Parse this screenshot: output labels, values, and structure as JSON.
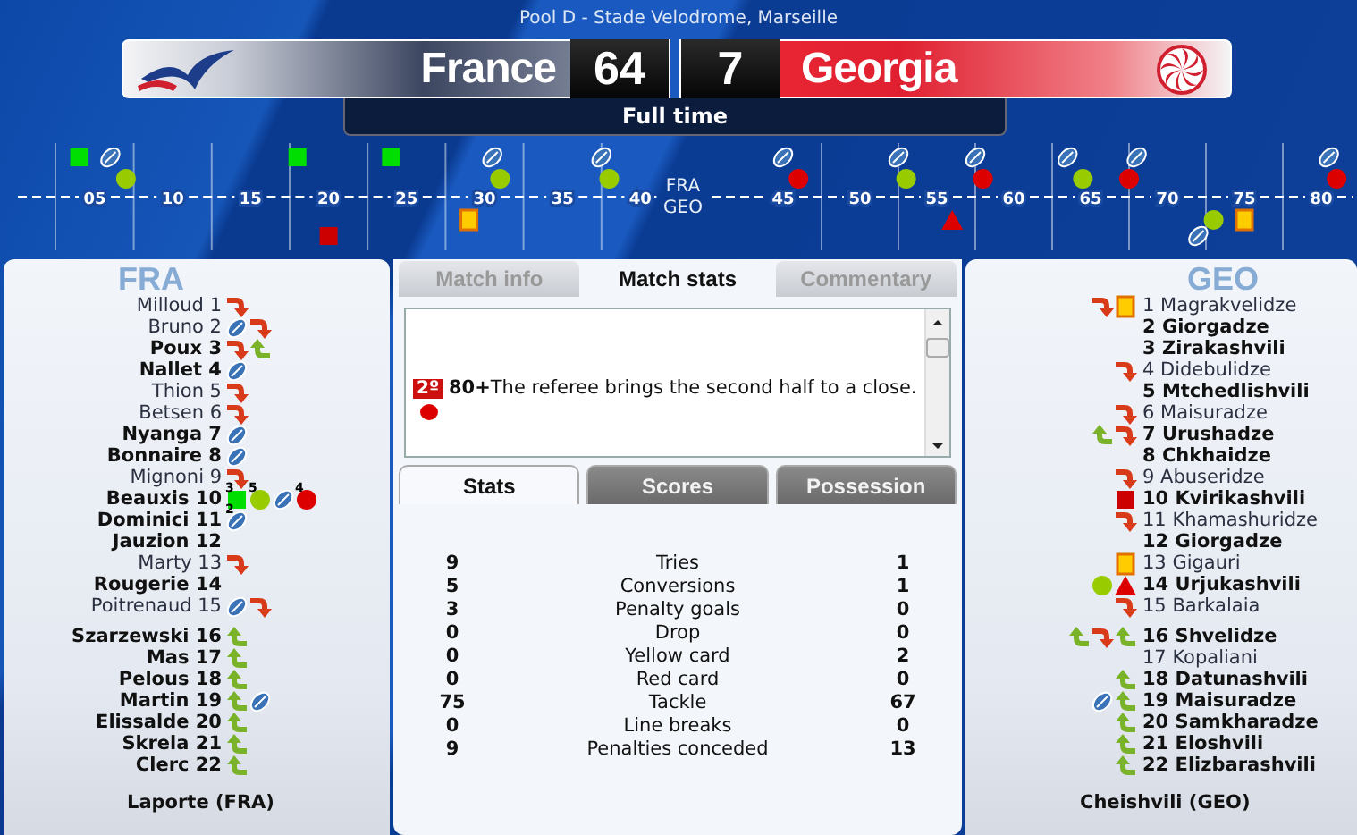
{
  "header": {
    "venue": "Pool D - Stade Velodrome, Marseille",
    "home": {
      "name": "France",
      "score": "64"
    },
    "away": {
      "name": "Georgia",
      "score": "7"
    },
    "status": "Full time"
  },
  "timeline": {
    "home_label": "FRA",
    "away_label": "GEO",
    "minute_labels": [
      "05",
      "10",
      "15",
      "20",
      "25",
      "30",
      "35",
      "40",
      "45",
      "50",
      "55",
      "60",
      "65",
      "70",
      "75",
      "80"
    ]
  },
  "teams": [
    {
      "code": "FRA",
      "starters": [
        {
          "name": "Milloud",
          "number": "1",
          "bold": false,
          "events": [
            {
              "kind": "sub_off"
            }
          ]
        },
        {
          "name": "Bruno",
          "number": "2",
          "bold": false,
          "events": [
            {
              "kind": "try"
            },
            {
              "kind": "sub_off"
            }
          ]
        },
        {
          "name": "Poux",
          "number": "3",
          "bold": true,
          "events": [
            {
              "kind": "sub_off"
            },
            {
              "kind": "sub_on"
            }
          ]
        },
        {
          "name": "Nallet",
          "number": "4",
          "bold": true,
          "events": [
            {
              "kind": "try"
            }
          ]
        },
        {
          "name": "Thion",
          "number": "5",
          "bold": false,
          "events": [
            {
              "kind": "sub_off"
            }
          ]
        },
        {
          "name": "Betsen",
          "number": "6",
          "bold": false,
          "events": [
            {
              "kind": "sub_off"
            }
          ]
        },
        {
          "name": "Nyanga",
          "number": "7",
          "bold": true,
          "events": [
            {
              "kind": "try"
            }
          ]
        },
        {
          "name": "Bonnaire",
          "number": "8",
          "bold": true,
          "events": [
            {
              "kind": "try"
            }
          ]
        },
        {
          "name": "Mignoni",
          "number": "9",
          "bold": false,
          "events": [
            {
              "kind": "sub_off"
            }
          ]
        },
        {
          "name": "Beauxis",
          "number": "10",
          "bold": true,
          "events": [
            {
              "kind": "penalty",
              "count": "3"
            },
            {
              "kind": "conversion",
              "count": "5"
            },
            {
              "kind": "try"
            },
            {
              "kind": "missed",
              "count": "4"
            }
          ]
        },
        {
          "name": "Dominici",
          "number": "11",
          "bold": true,
          "events": [
            {
              "kind": "try",
              "count": "2"
            }
          ]
        },
        {
          "name": "Jauzion",
          "number": "12",
          "bold": true
        },
        {
          "name": "Marty",
          "number": "13",
          "bold": false,
          "events": [
            {
              "kind": "sub_off"
            }
          ]
        },
        {
          "name": "Rougerie",
          "number": "14",
          "bold": true
        },
        {
          "name": "Poitrenaud",
          "number": "15",
          "bold": false,
          "events": [
            {
              "kind": "try"
            },
            {
              "kind": "sub_off"
            }
          ]
        }
      ],
      "replacements": [
        {
          "name": "Szarzewski",
          "number": "16",
          "bold": true,
          "events": [
            {
              "kind": "sub_on"
            }
          ]
        },
        {
          "name": "Mas",
          "number": "17",
          "bold": true,
          "events": [
            {
              "kind": "sub_on"
            }
          ]
        },
        {
          "name": "Pelous",
          "number": "18",
          "bold": true,
          "events": [
            {
              "kind": "sub_on"
            }
          ]
        },
        {
          "name": "Martin",
          "number": "19",
          "bold": true,
          "events": [
            {
              "kind": "sub_on"
            },
            {
              "kind": "try"
            }
          ]
        },
        {
          "name": "Elissalde",
          "number": "20",
          "bold": true,
          "events": [
            {
              "kind": "sub_on"
            }
          ]
        },
        {
          "name": "Skrela",
          "number": "21",
          "bold": true,
          "events": [
            {
              "kind": "sub_on"
            }
          ]
        },
        {
          "name": "Clerc",
          "number": "22",
          "bold": true,
          "events": [
            {
              "kind": "sub_on"
            }
          ]
        }
      ],
      "coach": "Laporte (FRA)"
    },
    {
      "code": "GEO",
      "starters": [
        {
          "name": "Magrakvelidze",
          "number": "1",
          "bold": false,
          "events": [
            {
              "kind": "sub_off"
            },
            {
              "kind": "yellow"
            }
          ]
        },
        {
          "name": "Giorgadze",
          "number": "2",
          "bold": true
        },
        {
          "name": "Zirakashvili",
          "number": "3",
          "bold": true
        },
        {
          "name": "Didebulidze",
          "number": "4",
          "bold": false,
          "events": [
            {
              "kind": "sub_off"
            }
          ]
        },
        {
          "name": "Mtchedlishvili",
          "number": "5",
          "bold": true
        },
        {
          "name": "Maisuradze",
          "number": "6",
          "bold": false,
          "events": [
            {
              "kind": "sub_off"
            }
          ]
        },
        {
          "name": "Urushadze",
          "number": "7",
          "bold": true,
          "events": [
            {
              "kind": "sub_on"
            },
            {
              "kind": "sub_off"
            }
          ]
        },
        {
          "name": "Chkhaidze",
          "number": "8",
          "bold": true
        },
        {
          "name": "Abuseridze",
          "number": "9",
          "bold": false,
          "events": [
            {
              "kind": "sub_off"
            }
          ]
        },
        {
          "name": "Kvirikashvili",
          "number": "10",
          "bold": true,
          "events": [
            {
              "kind": "missed_penalty"
            }
          ]
        },
        {
          "name": "Khamashuridze",
          "number": "11",
          "bold": false,
          "events": [
            {
              "kind": "sub_off"
            }
          ]
        },
        {
          "name": "Giorgadze",
          "number": "12",
          "bold": true
        },
        {
          "name": "Gigauri",
          "number": "13",
          "bold": false,
          "events": [
            {
              "kind": "yellow"
            }
          ]
        },
        {
          "name": "Urjukashvili",
          "number": "14",
          "bold": true,
          "events": [
            {
              "kind": "conversion"
            },
            {
              "kind": "missed_drop"
            }
          ]
        },
        {
          "name": "Barkalaia",
          "number": "15",
          "bold": false,
          "events": [
            {
              "kind": "sub_off"
            }
          ]
        }
      ],
      "replacements": [
        {
          "name": "Shvelidze",
          "number": "16",
          "bold": true,
          "events": [
            {
              "kind": "sub_on"
            },
            {
              "kind": "sub_off"
            },
            {
              "kind": "sub_on"
            }
          ]
        },
        {
          "name": "Kopaliani",
          "number": "17",
          "bold": false
        },
        {
          "name": "Datunashvili",
          "number": "18",
          "bold": true,
          "events": [
            {
              "kind": "sub_on"
            }
          ]
        },
        {
          "name": "Maisuradze",
          "number": "19",
          "bold": true,
          "events": [
            {
              "kind": "try"
            },
            {
              "kind": "sub_on"
            }
          ]
        },
        {
          "name": "Samkharadze",
          "number": "20",
          "bold": true,
          "events": [
            {
              "kind": "sub_on"
            }
          ]
        },
        {
          "name": "Eloshvili",
          "number": "21",
          "bold": true,
          "events": [
            {
              "kind": "sub_on"
            }
          ]
        },
        {
          "name": "Elizbarashvili",
          "number": "22",
          "bold": true,
          "events": [
            {
              "kind": "sub_on"
            }
          ]
        }
      ],
      "coach": "Cheishvili (GEO)"
    }
  ],
  "tabs": [
    {
      "label": "Match info",
      "selected": false
    },
    {
      "label": "Match stats",
      "selected": true
    },
    {
      "label": "Commentary",
      "selected": false
    }
  ],
  "commentary": {
    "period": "2º",
    "text": "**80+**The referee brings the second half to a close."
  },
  "subtabs": [
    {
      "label": "Stats",
      "selected": true
    },
    {
      "label": "Scores",
      "selected": false
    },
    {
      "label": "Possession",
      "selected": false
    }
  ],
  "stats": [
    {
      "home": "9",
      "label": "Tries",
      "away": "1"
    },
    {
      "home": "5",
      "label": "Conversions",
      "away": "1"
    },
    {
      "home": "3",
      "label": "Penalty goals",
      "away": "0"
    },
    {
      "home": "0",
      "label": "Drop",
      "away": "0"
    },
    {
      "home": "0",
      "label": "Yellow card",
      "away": "2"
    },
    {
      "home": "0",
      "label": "Red card",
      "away": "0"
    },
    {
      "home": "75",
      "label": "Tackle",
      "away": "67"
    },
    {
      "home": "0",
      "label": "Line breaks",
      "away": "0"
    },
    {
      "home": "9",
      "label": "Penalties conceded",
      "away": "13"
    }
  ]
}
